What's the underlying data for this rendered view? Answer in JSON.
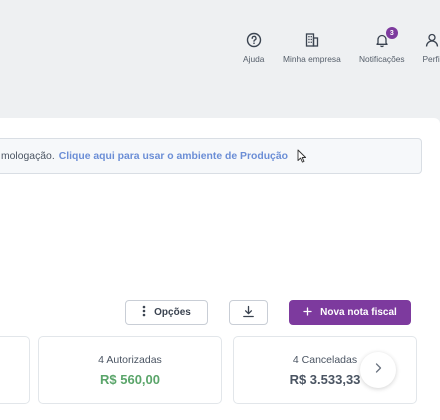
{
  "header": {
    "items": [
      {
        "label": "Ajuda",
        "icon": "help-circle-icon"
      },
      {
        "label": "Minha empresa",
        "icon": "building-icon"
      },
      {
        "label": "Notificações",
        "icon": "bell-icon",
        "badge": "3"
      },
      {
        "label": "Perfil",
        "icon": "user-icon"
      }
    ]
  },
  "notice": {
    "text": "mologação.",
    "link": "Clique aqui para usar o ambiente de Produção"
  },
  "toolbar": {
    "options_label": "Opções",
    "options_icon": "kebab-icon",
    "download_icon": "download-icon",
    "new_invoice_label": "Nova nota fiscal",
    "new_invoice_icon": "plus-icon"
  },
  "stats": [
    {
      "title": "4 Autorizadas",
      "value": "R$ 560,00",
      "color": "#5aa56a"
    },
    {
      "title": "4 Canceladas",
      "value": "R$ 3.533,33",
      "color": "#4a5462"
    }
  ],
  "colors": {
    "accent": "#7d3a9e",
    "link": "#6b8ed6",
    "success": "#5aa56a"
  }
}
